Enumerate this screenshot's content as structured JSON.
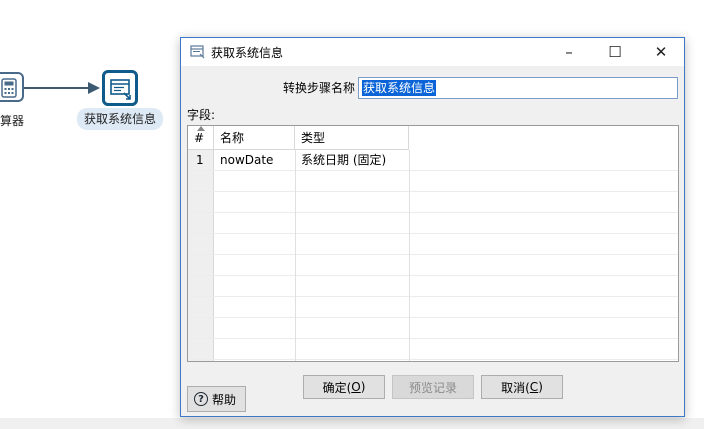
{
  "canvas": {
    "left_step_label": "算器",
    "main_step_label": "获取系统信息",
    "left_step_icon": "calculator-icon",
    "main_step_icon": "system-info-icon"
  },
  "dialog": {
    "title": "获取系统信息",
    "title_icon": "window-app-icon",
    "window_buttons": {
      "minimize": "–",
      "maximize": "☐",
      "close": "✕"
    },
    "step_name_label": "转换步骤名称",
    "step_name_value": "获取系统信息",
    "fields_label": "字段:",
    "table": {
      "columns": [
        "#",
        "名称",
        "类型"
      ],
      "rows": [
        {
          "num": "1",
          "name": "nowDate",
          "type": "系统日期 (固定)"
        }
      ]
    },
    "buttons": {
      "ok_label": "确定(",
      "ok_mnemonic": "O",
      "preview_label": "预览记录",
      "cancel_label": "取消(",
      "cancel_mnemonic": "C",
      "help_label": "帮助",
      "close_paren": ")"
    }
  },
  "colors": {
    "accent": "#0e5a8a",
    "selection": "#0a64d8",
    "dialog_border": "#3b79c6"
  }
}
